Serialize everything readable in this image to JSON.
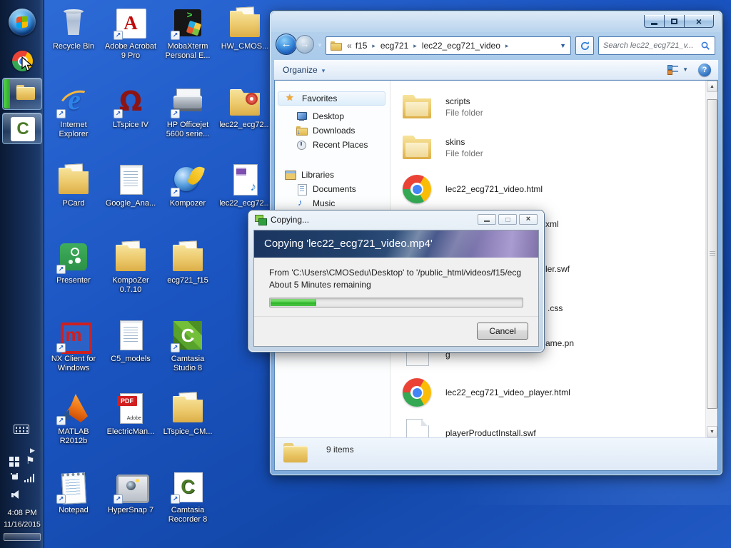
{
  "desktop": {
    "icons": [
      {
        "label": "Recycle Bin",
        "icon": "recycle"
      },
      {
        "label": "Adobe Acrobat 9 Pro",
        "icon": "acrobat sc"
      },
      {
        "label": "MobaXterm Personal E...",
        "icon": "mobaxterm sc"
      },
      {
        "label": "HW_CMOS...",
        "icon": "folder paper"
      },
      {
        "label": "Internet Explorer",
        "icon": "ie sc"
      },
      {
        "label": "LTspice IV",
        "icon": "ltspice sc"
      },
      {
        "label": "HP Officejet 5600 serie...",
        "icon": "printer sc"
      },
      {
        "label": "lec22_ecg72...",
        "icon": "folder media"
      },
      {
        "label": "PCard",
        "icon": "folder paper"
      },
      {
        "label": "Google_Ana...",
        "icon": "docpage"
      },
      {
        "label": "Kompozer",
        "icon": "kompozer sc"
      },
      {
        "label": "lec22_ecg72...",
        "icon": "mediafile"
      },
      {
        "label": "Presenter",
        "icon": "presenter sc"
      },
      {
        "label": "KompoZer 0.7.10",
        "icon": "folder paper"
      },
      {
        "label": "ecg721_f15",
        "icon": "folder paper"
      },
      {
        "label": "NX Client for Windows",
        "icon": "nx sc"
      },
      {
        "label": "C5_models",
        "icon": "docpage"
      },
      {
        "label": "Camtasia Studio 8",
        "icon": "camtasia-green sc"
      },
      {
        "label": "MATLAB R2012b",
        "icon": "matlab sc"
      },
      {
        "label": "ElectricMan...",
        "icon": "pdf"
      },
      {
        "label": "LTspice_CM...",
        "icon": "folder paper"
      },
      {
        "label": "Notepad",
        "icon": "notepad sc"
      },
      {
        "label": "HyperSnap 7",
        "icon": "hypersnap sc"
      },
      {
        "label": "Camtasia Recorder 8",
        "icon": "camtasia-white sc"
      }
    ]
  },
  "taskbar": {
    "clock": {
      "time": "4:08 PM",
      "date": "11/16/2015"
    }
  },
  "explorer": {
    "breadcrumb": {
      "overflow": "«",
      "sep": "▸",
      "segments": [
        "f15",
        "ecg721",
        "lec22_ecg721_video"
      ]
    },
    "search_text": "Search lec22_ecg721_v...",
    "toolbar": {
      "organize_label": "Organize"
    },
    "sidebar": {
      "favorites_label": "Favorites",
      "favorites_items": [
        "Desktop",
        "Downloads",
        "Recent Places"
      ],
      "libraries_label": "Libraries",
      "libraries_items": [
        "Documents",
        "Music"
      ]
    },
    "files": {
      "rows": [
        {
          "name": "scripts",
          "type": "File folder"
        },
        {
          "name": "skins",
          "type": "File folder"
        },
        {
          "name": "lec22_ecg721_video.html"
        },
        {
          "visible_tail": "xml"
        },
        {
          "visible_tail": "ler.swf"
        },
        {
          "visible_tail": ".css"
        },
        {
          "visible_tail": "ame.pn",
          "visible_tail_line2": "g"
        },
        {
          "name": "lec22_ecg721_video_player.html"
        },
        {
          "name": "playerProductInstall.swf"
        }
      ]
    },
    "status_text": "9 items"
  },
  "dialog": {
    "titlebar_text": "Copying...",
    "heading": "Copying 'lec22_ecg721_video.mp4'",
    "from_line": "From 'C:\\Users\\CMOSedu\\Desktop' to '/public_html/videos/f15/ecg",
    "remaining_line": "About 5 Minutes remaining",
    "progress_percent": 18,
    "cancel_label": "Cancel"
  }
}
